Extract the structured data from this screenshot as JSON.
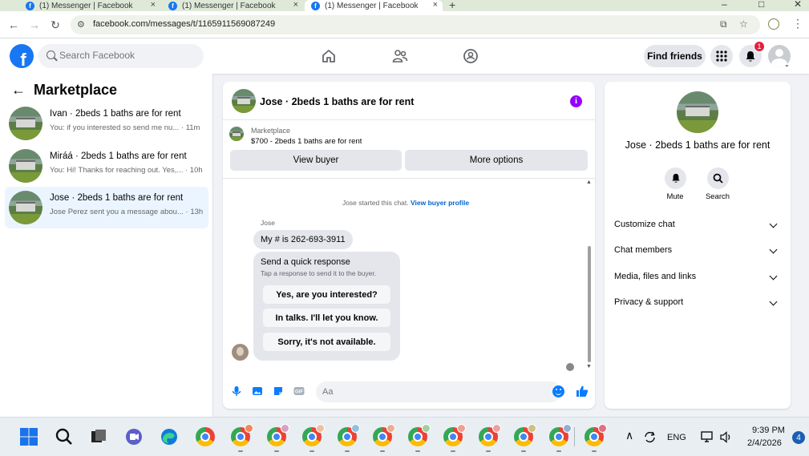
{
  "browser": {
    "tabs": [
      {
        "label": "(1) Messenger | Facebook"
      },
      {
        "label": "(1) Messenger | Facebook"
      },
      {
        "label": "(1) Messenger | Facebook"
      }
    ],
    "url": "facebook.com/messages/t/1165911569087249"
  },
  "fb_header": {
    "logo_letter": "f",
    "search_placeholder": "Search Facebook",
    "find_friends_label": "Find friends",
    "notifications_count": "1"
  },
  "sidebar": {
    "title": "Marketplace",
    "conversations": [
      {
        "title": "Ivan · 2beds 1 baths are for rent",
        "preview": "You: if you interested so send me nu... · 11m"
      },
      {
        "title": "Miráá · 2beds 1 baths are for rent",
        "preview": "You: Hi! Thanks for reaching out. Yes,... · 10h"
      },
      {
        "title": "Jose · 2beds 1 baths are for rent",
        "preview": "Jose Perez sent you a message abou... · 13h"
      }
    ]
  },
  "chat": {
    "title": "Jose · 2beds 1 baths are for rent",
    "marketplace_label": "Marketplace",
    "listing_price": "$700 - 2beds 1 baths are for rent",
    "view_buyer_label": "View buyer",
    "more_options_label": "More options",
    "started_text": "Jose started this chat.",
    "view_buyer_profile_label": "View buyer profile",
    "sender_name": "Jose",
    "message": "My # is 262-693-3911",
    "quick_title": "Send a quick response",
    "quick_subtitle": "Tap a response to send it to the buyer.",
    "quick_responses": [
      "Yes, are you interested?",
      "In talks. I'll let you know.",
      "Sorry, it's not available."
    ],
    "input_placeholder": "Aa"
  },
  "details": {
    "title": "Jose · 2beds 1 baths are for rent",
    "actions": [
      {
        "label": "Mute"
      },
      {
        "label": "Search"
      }
    ],
    "sections": [
      "Customize chat",
      "Chat members",
      "Media, files and links",
      "Privacy & support"
    ]
  },
  "taskbar": {
    "language": "ENG",
    "time": "9:39 PM",
    "date": "2/4/2026",
    "notification_count": "4"
  },
  "colors": {
    "facebook_blue": "#1877f2",
    "messenger_purple": "#9400ff",
    "messenger_blue": "#0a7cff",
    "notification_red": "#e41e3f"
  }
}
